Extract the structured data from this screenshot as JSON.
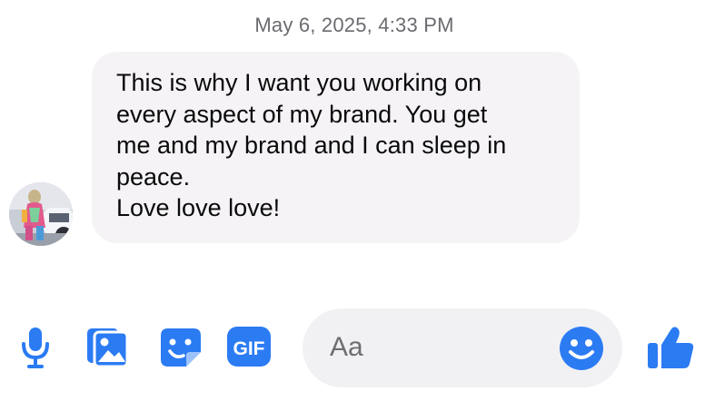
{
  "thread": {
    "timestamp": "May 6, 2025, 4:33 PM",
    "message": {
      "lines": [
        "This is why I want you working on",
        "every aspect of my brand. You get",
        "me and my brand and I can sleep in",
        "peace.",
        "Love love love!"
      ]
    }
  },
  "composer": {
    "placeholder": "Aa",
    "tools": [
      "microphone-icon",
      "photo-icon",
      "sticker-icon",
      "gif-icon"
    ],
    "gif_label": "GIF",
    "emoji_icon": "emoji-icon",
    "send_icon": "thumbs-up-icon"
  },
  "colors": {
    "accent": "#2b7bf3",
    "bubble": "#f5f3f6",
    "input": "#f1f1f4",
    "timestamp": "#6b6b70"
  }
}
